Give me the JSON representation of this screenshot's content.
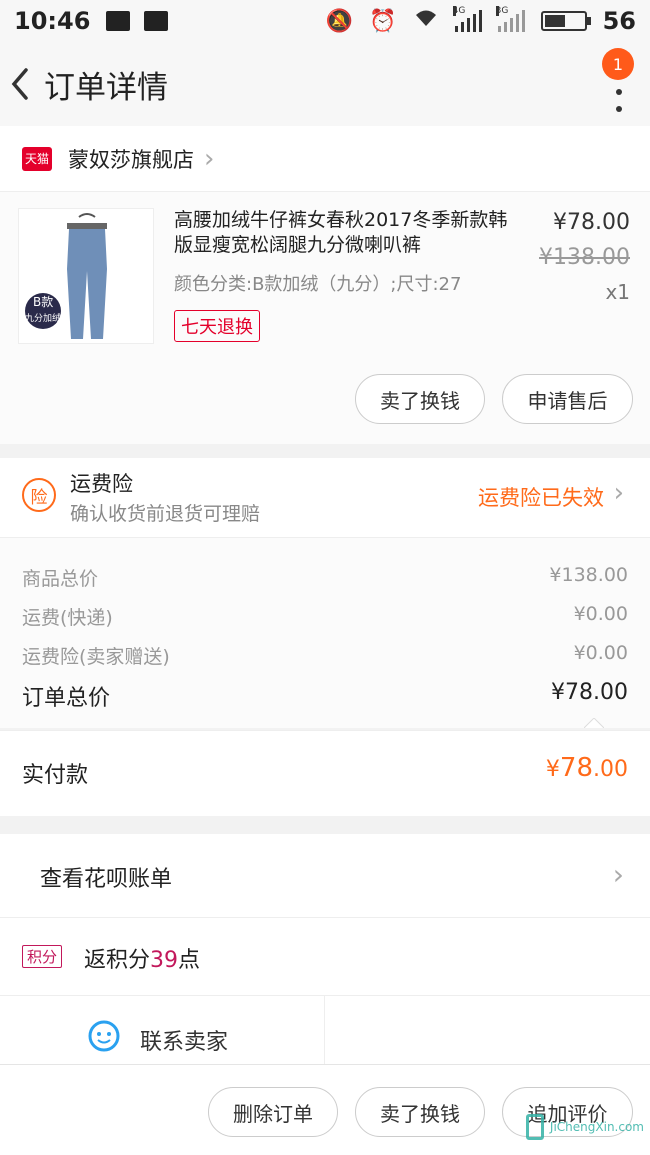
{
  "status_bar": {
    "time": "10:46",
    "net1": "4G",
    "net2": "3G",
    "battery": "56"
  },
  "nav": {
    "title": "订单详情",
    "badge": "1"
  },
  "shop": {
    "badge": "天猫",
    "name": "蒙奴莎旗舰店"
  },
  "product": {
    "title": "高腰加绒牛仔裤女春秋2017冬季新款韩版显瘦宽松阔腿九分微喇叭裤",
    "spec": "颜色分类:B款加绒（九分）;尺寸:27",
    "return_tag": "七天退换",
    "price": "¥78.00",
    "original_price": "¥138.00",
    "qty": "x1",
    "image_label1": "B款",
    "image_label2": "九分加绒",
    "btn_sell": "卖了换钱",
    "btn_aftersale": "申请售后"
  },
  "insurance": {
    "icon_text": "险",
    "title": "运费险",
    "subtitle": "确认收货前退货可理赔",
    "status": "运费险已失效"
  },
  "summary": {
    "rows": [
      {
        "label": "商品总价",
        "value": "¥138.00"
      },
      {
        "label": "运费(快递)",
        "value": "¥0.00"
      },
      {
        "label": "运费险(卖家赠送)",
        "value": "¥0.00"
      }
    ],
    "total_label": "订单总价",
    "total_value": "¥78.00"
  },
  "paid": {
    "label": "实付款",
    "currency": "¥",
    "integer": "78",
    "decimal": ".00"
  },
  "huabei": {
    "label": "查看花呗账单"
  },
  "points": {
    "tag": "积分",
    "prefix": "返积分",
    "value": "39",
    "suffix": "点"
  },
  "contact": {
    "label": "联系卖家"
  },
  "bottom_bar": {
    "delete": "删除订单",
    "sell": "卖了换钱",
    "review": "追加评价"
  },
  "watermark": {
    "text": "JiChengXin.com"
  },
  "colors": {
    "accent_orange": "#ff6a1a",
    "tmall_red": "#e4002b",
    "points_pink": "#c2185b"
  }
}
